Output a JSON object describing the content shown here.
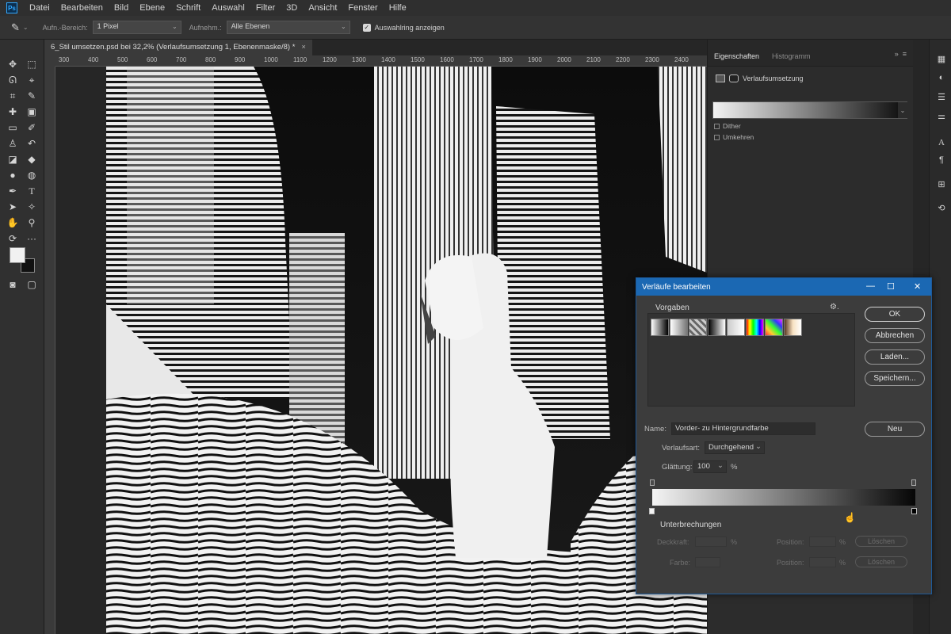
{
  "menubar": {
    "app_logo": "Ps",
    "items": [
      "Datei",
      "Bearbeiten",
      "Bild",
      "Ebene",
      "Schrift",
      "Auswahl",
      "Filter",
      "3D",
      "Ansicht",
      "Fenster",
      "Hilfe"
    ]
  },
  "options": {
    "sample_size_label": "Aufn.-Bereich:",
    "sample_size_value": "1 Pixel",
    "sample_label": "Aufnehm.:",
    "sample_value": "Alle Ebenen",
    "show_ring_label": "Auswahlring anzeigen",
    "show_ring_checked": true
  },
  "document": {
    "tab_title": "6_Stil umsetzen.psd bei 32,2% (Verlaufsumsetzung 1, Ebenenmaske/8) *",
    "ruler_ticks": [
      "300",
      "400",
      "500",
      "600",
      "700",
      "800",
      "900",
      "1000",
      "1100",
      "1200",
      "1300",
      "1400",
      "1500",
      "1600",
      "1700",
      "1800",
      "1900",
      "2000",
      "2100",
      "2200",
      "2300",
      "2400"
    ]
  },
  "properties_panel": {
    "tabs": [
      "Eigenschaften",
      "Histogramm"
    ],
    "active_tab": "Eigenschaften",
    "title": "Verlaufsumsetzung",
    "checkboxes": [
      "Dither",
      "Umkehren"
    ]
  },
  "gradient_editor": {
    "title": "Verläufe bearbeiten",
    "presets_label": "Vorgaben",
    "buttons": {
      "ok": "OK",
      "cancel": "Abbrechen",
      "load": "Laden...",
      "save": "Speichern...",
      "new": "Neu"
    },
    "name_label": "Name:",
    "name_value": "Vorder- zu Hintergrundfarbe",
    "type_label": "Verlaufsart:",
    "type_value": "Durchgehend",
    "smoothness_label": "Glättung:",
    "smoothness_value": "100",
    "smoothness_unit": "%",
    "stops_label": "Unterbrechungen",
    "opacity_label": "Deckkraft:",
    "opacity_unit": "%",
    "color_label": "Farbe:",
    "position_label_1": "Position:",
    "position_label_2": "Position:",
    "position_unit_1": "%",
    "position_unit_2": "%",
    "delete_label_1": "Löschen",
    "delete_label_2": "Löschen"
  },
  "colors": {
    "accent": "#1b68b3",
    "foreground": "#f1f1f1",
    "background": "#111111"
  }
}
